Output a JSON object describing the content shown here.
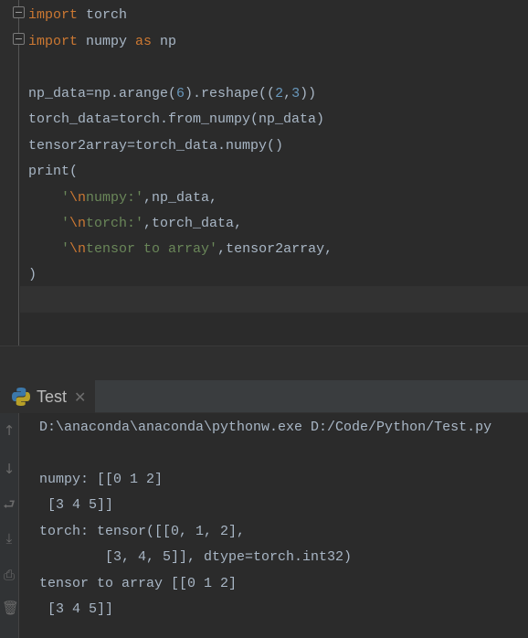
{
  "editor": {
    "lines": {
      "l1": {
        "kw": "import",
        "rest": " torch"
      },
      "l2": {
        "kw": "import",
        "mid": " numpy ",
        "kw2": "as",
        "rest": " np"
      },
      "l3": {
        "a": "np_data=np.arange(",
        "n1": "6",
        "b": ").reshape((",
        "n2": "2",
        "c": ",",
        "n3": "3",
        "d": "))"
      },
      "l4": "torch_data=torch.from_numpy(np_data)",
      "l5": "tensor2array=torch_data.numpy()",
      "l6": "print(",
      "l7": {
        "q1": "'",
        "esc": "\\n",
        "s": "numpy:'",
        "rest": ",np_data,"
      },
      "l8": {
        "q1": "'",
        "esc": "\\n",
        "s": "torch:'",
        "rest": ",torch_data,"
      },
      "l9": {
        "q1": "'",
        "esc": "\\n",
        "s": "tensor to array'",
        "rest": ",tensor2array,"
      },
      "l10": ")"
    }
  },
  "run_panel": {
    "tab_label": "Test",
    "tab_icon": "python-icon",
    "close_icon": "close-icon",
    "toolbar_icons": [
      "up-arrow-icon",
      "down-arrow-icon",
      "soft-wrap-icon",
      "scroll-to-end-icon",
      "print-icon",
      "trash-icon"
    ],
    "output": [
      "D:\\anaconda\\anaconda\\pythonw.exe D:/Code/Python/Test.py",
      "",
      "numpy: [[0 1 2]",
      " [3 4 5]]",
      "torch: tensor([[0, 1, 2],",
      "        [3, 4, 5]], dtype=torch.int32)",
      "tensor to array [[0 1 2]",
      " [3 4 5]]"
    ]
  },
  "colors": {
    "background": "#2b2b2b",
    "keyword": "#cc7832",
    "string": "#6a8759",
    "number": "#6897bb",
    "text": "#a9b7c6"
  }
}
